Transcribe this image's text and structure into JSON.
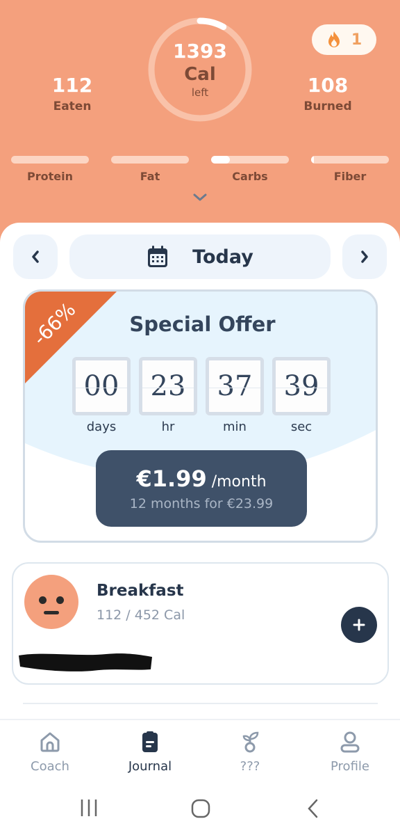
{
  "header": {
    "streak": {
      "icon": "flame-icon",
      "count": "1"
    },
    "calories": {
      "left_value": "1393",
      "unit": "Cal",
      "left_label": "left",
      "progress": 0.08
    },
    "eaten": {
      "value": "112",
      "label": "Eaten"
    },
    "burned": {
      "value": "108",
      "label": "Burned"
    },
    "macros": [
      {
        "label": "Protein",
        "progress": 0.0
      },
      {
        "label": "Fat",
        "progress": 0.0
      },
      {
        "label": "Carbs",
        "progress": 0.24
      },
      {
        "label": "Fiber",
        "progress": 0.04
      }
    ]
  },
  "date_nav": {
    "label": "Today",
    "prev_icon": "chevron-left-icon",
    "next_icon": "chevron-right-icon",
    "calendar_icon": "calendar-icon"
  },
  "offer": {
    "badge": "-66%",
    "title": "Special Offer",
    "timer": [
      {
        "value": "00",
        "label": "days"
      },
      {
        "value": "23",
        "label": "hr"
      },
      {
        "value": "37",
        "label": "min"
      },
      {
        "value": "39",
        "label": "sec"
      }
    ],
    "price": "€1.99",
    "period": " /month",
    "subtext": "12 months for €23.99"
  },
  "meal": {
    "title": "Breakfast",
    "calories": "112 / 452 Cal"
  },
  "tabs": [
    {
      "label": "Coach",
      "icon": "home-icon"
    },
    {
      "label": "Journal",
      "icon": "journal-icon",
      "active": true
    },
    {
      "label": "???",
      "icon": "sprout-icon"
    },
    {
      "label": "Profile",
      "icon": "person-icon"
    }
  ],
  "colors": {
    "header": "#f4a07d",
    "dark": "#27364b",
    "ribbon": "#e46f3c",
    "offer_bg": "#e6f4fd"
  }
}
